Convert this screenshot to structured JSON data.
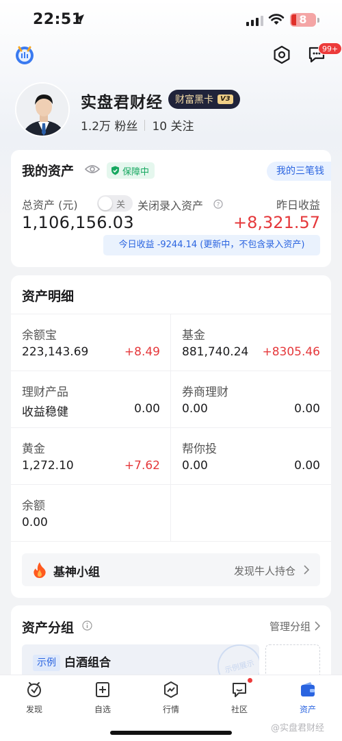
{
  "status_bar": {
    "time": "22:51",
    "battery": "8"
  },
  "header": {
    "message_badge": "99+"
  },
  "profile": {
    "name": "实盘君财经",
    "vip_label": "财富黑卡",
    "vip_level": "V3",
    "fans": "1.2万 粉丝",
    "following": "10 关注"
  },
  "assets": {
    "title": "我的资产",
    "protect_badge": "保障中",
    "three_money_link": "我的三笔钱",
    "total_label": "总资产 (元)",
    "toggle_text": "关",
    "toggle_desc": "关闭录入资产",
    "yesterday_label": "昨日收益",
    "total_value": "1,106,156.03",
    "yesterday_value": "+8,321.57",
    "today_note": "今日收益 -9244.14 (更新中，不包含录入资产)"
  },
  "details": {
    "title": "资产明细",
    "items": [
      {
        "name": "余额宝",
        "amount": "223,143.69",
        "change": "+8.49"
      },
      {
        "name": "基金",
        "amount": "881,740.24",
        "change": "+8305.46"
      },
      {
        "name": "理财产品",
        "amount": "收益稳健",
        "change": "0.00"
      },
      {
        "name": "券商理财",
        "amount": "0.00",
        "change": "0.00"
      },
      {
        "name": "黄金",
        "amount": "1,272.10",
        "change": "+7.62"
      },
      {
        "name": "帮你投",
        "amount": "0.00",
        "change": "0.00"
      },
      {
        "name": "余额",
        "amount": "0.00",
        "change": ""
      }
    ],
    "god_group": {
      "title": "基神小组",
      "subtitle": "发现牛人持仓"
    }
  },
  "groups": {
    "title": "资产分组",
    "manage": "管理分组",
    "sample_tag": "示例",
    "sample_name": "白酒组合",
    "sample_stamp": "示例展示"
  },
  "tabs": [
    {
      "label": "发现"
    },
    {
      "label": "自选"
    },
    {
      "label": "行情"
    },
    {
      "label": "社区"
    },
    {
      "label": "资产"
    }
  ],
  "watermark": "@实盘君财经",
  "colors": {
    "accent": "#2a64e0",
    "up": "#e5383b",
    "safe": "#17a860"
  }
}
